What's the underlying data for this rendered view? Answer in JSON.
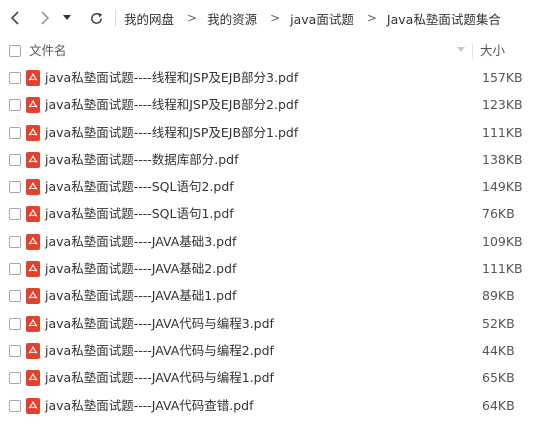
{
  "breadcrumb": [
    "我的网盘",
    "我的资源",
    "java面试题",
    "Java私塾面试题集合"
  ],
  "header": {
    "name_label": "文件名",
    "size_label": "大小"
  },
  "files": [
    {
      "name": "java私塾面试题----线程和JSP及EJB部分3.pdf",
      "size": "157KB"
    },
    {
      "name": "java私塾面试题----线程和JSP及EJB部分2.pdf",
      "size": "123KB"
    },
    {
      "name": "java私塾面试题----线程和JSP及EJB部分1.pdf",
      "size": "111KB"
    },
    {
      "name": "java私塾面试题----数据库部分.pdf",
      "size": "138KB"
    },
    {
      "name": "java私塾面试题----SQL语句2.pdf",
      "size": "149KB"
    },
    {
      "name": "java私塾面试题----SQL语句1.pdf",
      "size": "76KB"
    },
    {
      "name": "java私塾面试题----JAVA基础3.pdf",
      "size": "109KB"
    },
    {
      "name": "java私塾面试题----JAVA基础2.pdf",
      "size": "111KB"
    },
    {
      "name": "java私塾面试题----JAVA基础1.pdf",
      "size": "89KB"
    },
    {
      "name": "java私塾面试题----JAVA代码与编程3.pdf",
      "size": "52KB"
    },
    {
      "name": "java私塾面试题----JAVA代码与编程2.pdf",
      "size": "44KB"
    },
    {
      "name": "java私塾面试题----JAVA代码与编程1.pdf",
      "size": "65KB"
    },
    {
      "name": "java私塾面试题----JAVA代码查错.pdf",
      "size": "64KB"
    }
  ],
  "icons": {
    "back": "chevron-left-icon",
    "forward": "chevron-right-icon",
    "history": "caret-down-icon",
    "refresh": "refresh-icon",
    "file": "pdf-file-icon"
  },
  "colors": {
    "pdf_icon": "#e2412e",
    "text": "#333333"
  }
}
